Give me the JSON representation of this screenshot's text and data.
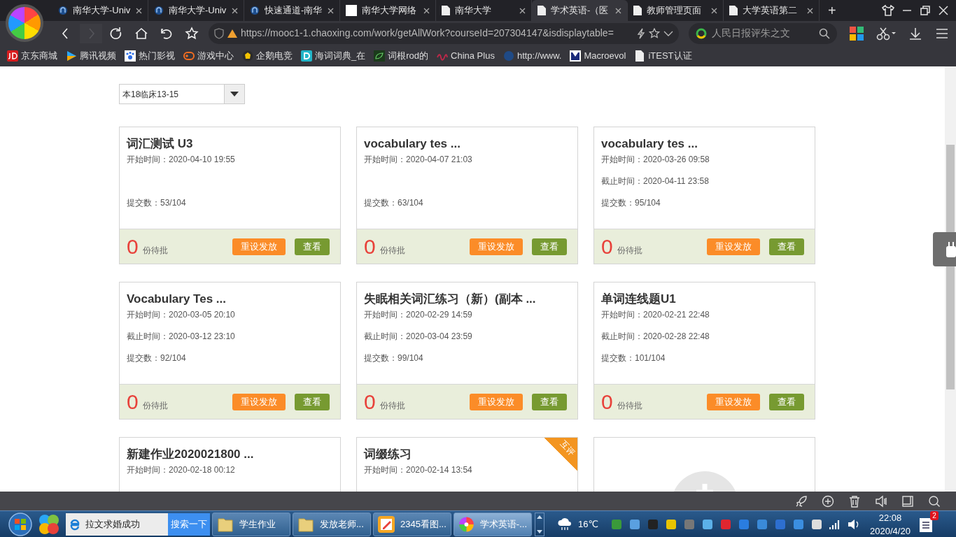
{
  "browser": {
    "tabs": [
      {
        "label": "南华大学-Univ",
        "kind": "globe",
        "selected": false
      },
      {
        "label": "南华大学-Univ",
        "kind": "globe",
        "selected": false
      },
      {
        "label": "快速通道-南华",
        "kind": "globe",
        "selected": false
      },
      {
        "label": "南华大学网络",
        "kind": "blank",
        "selected": false
      },
      {
        "label": "南华大学",
        "kind": "page",
        "selected": false
      },
      {
        "label": "学术英语-（医",
        "kind": "page",
        "selected": true
      },
      {
        "label": "教师管理页面",
        "kind": "page",
        "selected": false
      },
      {
        "label": "大学英语第二",
        "kind": "page",
        "selected": false
      }
    ],
    "new_tab": "+",
    "nav_buttons": [
      {
        "kind": "back",
        "disabled": false
      },
      {
        "kind": "forward",
        "disabled": true
      },
      {
        "kind": "reload",
        "disabled": false
      },
      {
        "kind": "home",
        "disabled": false
      },
      {
        "kind": "undo",
        "disabled": false
      },
      {
        "kind": "star",
        "disabled": false
      }
    ],
    "url": "https://mooc1-1.chaoxing.com/work/getAllWork?courseId=207304147&isdisplaytable=",
    "search": {
      "placeholder": "人民日报评朱之文"
    },
    "bookmarks": [
      {
        "label": "京东商城",
        "kind": "jd"
      },
      {
        "label": "腾讯视频",
        "kind": "play"
      },
      {
        "label": "热门影视",
        "kind": "paw"
      },
      {
        "label": "游戏中心",
        "kind": "gamepad"
      },
      {
        "label": "企鹅电竞",
        "kind": "crest"
      },
      {
        "label": "海词词典_在",
        "kind": "d"
      },
      {
        "label": "词根rod的",
        "kind": "leaf"
      },
      {
        "label": "China Plus",
        "kind": "wave"
      },
      {
        "label": "http://www.",
        "kind": "globe"
      },
      {
        "label": "Macroevol",
        "kind": "m"
      },
      {
        "label": "iTEST认证",
        "kind": "page"
      }
    ]
  },
  "page": {
    "class_select": "本18临床13-15",
    "cards": [
      {
        "kind": "assignment",
        "title": "词汇测试 U3",
        "start": "开始时间：2020-04-10 19:55",
        "submitted": "提交数：53/104",
        "pending": "0",
        "pending_label": "份待批",
        "buttons": [
          {
            "label": "重设发放",
            "kind": "reset"
          },
          {
            "label": "查看",
            "kind": "view"
          }
        ]
      },
      {
        "kind": "assignment",
        "title": "vocabulary tes ...",
        "start": "开始时间：2020-04-07 21:03",
        "submitted": "提交数：63/104",
        "pending": "0",
        "pending_label": "份待批",
        "buttons": [
          {
            "label": "重设发放",
            "kind": "reset"
          },
          {
            "label": "查看",
            "kind": "view"
          }
        ]
      },
      {
        "kind": "assignment",
        "title": "vocabulary tes ...",
        "start": "开始时间：2020-03-26 09:58",
        "end": "截止时间：2020-04-11 23:58",
        "submitted": "提交数：95/104",
        "pending": "0",
        "pending_label": "份待批",
        "buttons": [
          {
            "label": "重设发放",
            "kind": "reset"
          },
          {
            "label": "查看",
            "kind": "view"
          }
        ]
      },
      {
        "kind": "assignment",
        "title": "Vocabulary Tes ...",
        "start": "开始时间：2020-03-05 20:10",
        "end": "截止时间：2020-03-12 23:10",
        "submitted": "提交数：92/104",
        "pending": "0",
        "pending_label": "份待批",
        "buttons": [
          {
            "label": "重设发放",
            "kind": "reset"
          },
          {
            "label": "查看",
            "kind": "view"
          }
        ]
      },
      {
        "kind": "assignment",
        "title": "失眠相关词汇练习（新）(副本 ...",
        "start": "开始时间：2020-02-29 14:59",
        "end": "截止时间：2020-03-04 23:59",
        "submitted": "提交数：99/104",
        "pending": "0",
        "pending_label": "份待批",
        "buttons": [
          {
            "label": "重设发放",
            "kind": "reset"
          },
          {
            "label": "查看",
            "kind": "view"
          }
        ]
      },
      {
        "kind": "assignment",
        "title": "单词连线题U1",
        "start": "开始时间：2020-02-21 22:48",
        "end": "截止时间：2020-02-28 22:48",
        "submitted": "提交数：101/104",
        "pending": "0",
        "pending_label": "份待批",
        "buttons": [
          {
            "label": "重设发放",
            "kind": "reset"
          },
          {
            "label": "查看",
            "kind": "view"
          }
        ]
      },
      {
        "kind": "assignment",
        "title": "新建作业2020021800 ...",
        "start": "开始时间：2020-02-18 00:12"
      },
      {
        "kind": "assignment",
        "title": "词缀练习",
        "start": "开始时间：2020-02-14 13:54",
        "ribbon": "互评"
      },
      {
        "kind": "add"
      }
    ]
  },
  "taskbar": {
    "search_value": "拉文求婚成功",
    "search_button": "搜索一下",
    "tasks": [
      {
        "label": "学生作业",
        "kind": "folder",
        "selected": false
      },
      {
        "label": "发放老师...",
        "kind": "folder",
        "selected": false
      },
      {
        "label": "2345看图...",
        "kind": "viewer",
        "selected": false
      },
      {
        "label": "学术英语-...",
        "kind": "browser",
        "selected": true
      }
    ],
    "temperature": "16℃",
    "time": "22:08",
    "date": "2020/4/20",
    "notifications": "2"
  }
}
